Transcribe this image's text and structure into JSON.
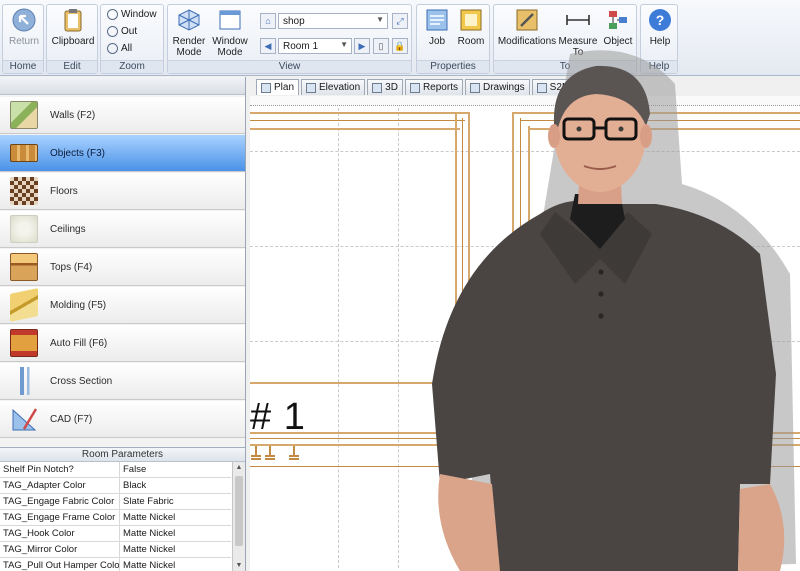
{
  "ribbon": {
    "home": {
      "group_label": "Home",
      "return_label": "Return"
    },
    "edit": {
      "group_label": "Edit",
      "clipboard_label": "Clipboard"
    },
    "zoom": {
      "group_label": "Zoom",
      "window_label": "Window",
      "out_label": "Out",
      "all_label": "All"
    },
    "view": {
      "group_label": "View",
      "render_mode_line1": "Render",
      "render_mode_line2": "Mode",
      "window_mode_line1": "Window",
      "window_mode_line2": "Mode",
      "location_value": "shop",
      "room_value": "Room 1"
    },
    "properties": {
      "group_label": "Properties",
      "job_label": "Job",
      "room_label": "Room"
    },
    "tools": {
      "modifications_label": "Modifications",
      "measure_line1": "Measure",
      "measure_line2": "To",
      "object_label": "Object",
      "group_label": "To"
    },
    "help": {
      "help_label": "Help",
      "group_label": "Help"
    }
  },
  "categories": [
    {
      "label": "Walls (F2)",
      "icon": "walls-icon",
      "selected": false
    },
    {
      "label": "Objects (F3)",
      "icon": "objects-icon",
      "selected": true
    },
    {
      "label": "Floors",
      "icon": "floors-icon",
      "selected": false
    },
    {
      "label": "Ceilings",
      "icon": "ceilings-icon",
      "selected": false
    },
    {
      "label": "Tops (F4)",
      "icon": "tops-icon",
      "selected": false
    },
    {
      "label": "Molding (F5)",
      "icon": "molding-icon",
      "selected": false
    },
    {
      "label": "Auto Fill (F6)",
      "icon": "auto-fill-icon",
      "selected": false
    },
    {
      "label": "Cross Section",
      "icon": "cross-section-icon",
      "selected": false
    },
    {
      "label": "CAD (F7)",
      "icon": "cad-icon",
      "selected": false
    }
  ],
  "room_parameters": {
    "title": "Room Parameters",
    "rows": [
      {
        "key": "Shelf Pin Notch?",
        "value": "False"
      },
      {
        "key": "TAG_Adapter Color",
        "value": "Black"
      },
      {
        "key": "TAG_Engage Fabric Color",
        "value": "Slate Fabric"
      },
      {
        "key": "TAG_Engage Frame Color",
        "value": "Matte Nickel"
      },
      {
        "key": "TAG_Hook Color",
        "value": "Matte Nickel"
      },
      {
        "key": "TAG_Mirror Color",
        "value": "Matte Nickel"
      },
      {
        "key": "TAG_Pull Out Hamper Color",
        "value": "Matte Nickel"
      }
    ]
  },
  "tabs": [
    {
      "label": "Plan",
      "active": true
    },
    {
      "label": "Elevation",
      "active": false
    },
    {
      "label": "3D",
      "active": false
    },
    {
      "label": "Reports",
      "active": false
    },
    {
      "label": "Drawings",
      "active": false
    },
    {
      "label": "S2M Center",
      "active": false
    }
  ],
  "canvas": {
    "room_label": "# 1"
  },
  "colors": {
    "accent": "#4a92e8",
    "wall": "#d7a86b",
    "ribbon": "#e4e9f1"
  }
}
